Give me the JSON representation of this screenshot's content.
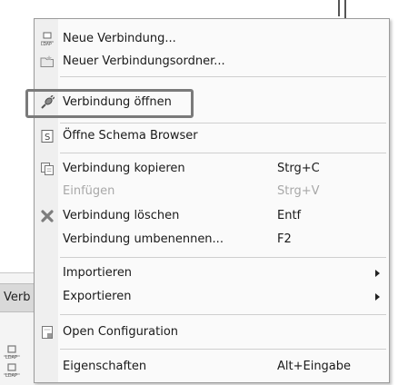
{
  "background": {
    "tab_label": "Verb",
    "vertical_bars": true
  },
  "menu": {
    "items": [
      {
        "label": "Neue Verbindung...",
        "shortcut": "",
        "icon": "new-connection-icon",
        "disabled": false
      },
      {
        "label": "Neuer Verbindungsordner...",
        "shortcut": "",
        "icon": "new-folder-icon",
        "disabled": false
      },
      {
        "label": "Verbindung öffnen",
        "shortcut": "",
        "icon": "open-connection-icon",
        "disabled": false
      },
      {
        "label": "Öffne Schema Browser",
        "shortcut": "",
        "icon": "schema-browser-icon",
        "disabled": false
      },
      {
        "label": "Verbindung kopieren",
        "shortcut": "Strg+C",
        "icon": "copy-icon",
        "disabled": false
      },
      {
        "label": "Einfügen",
        "shortcut": "Strg+V",
        "icon": "",
        "disabled": true
      },
      {
        "label": "Verbindung löschen",
        "shortcut": "Entf",
        "icon": "delete-icon",
        "disabled": false
      },
      {
        "label": "Verbindung umbenennen...",
        "shortcut": "F2",
        "icon": "",
        "disabled": false
      },
      {
        "label": "Importieren",
        "shortcut": "",
        "icon": "",
        "disabled": false,
        "submenu": true
      },
      {
        "label": "Exportieren",
        "shortcut": "",
        "icon": "",
        "disabled": false,
        "submenu": true
      },
      {
        "label": "Open Configuration",
        "shortcut": "",
        "icon": "configuration-icon",
        "disabled": false
      },
      {
        "label": "Eigenschaften",
        "shortcut": "Alt+Eingabe",
        "icon": "",
        "disabled": false
      }
    ]
  },
  "colors": {
    "menu_bg": "#fafafa",
    "gutter_bg": "#efefef",
    "disabled_text": "#a8a8a8",
    "highlight_border": "#7a7a7a",
    "delete_icon": "#7d7d7d"
  }
}
